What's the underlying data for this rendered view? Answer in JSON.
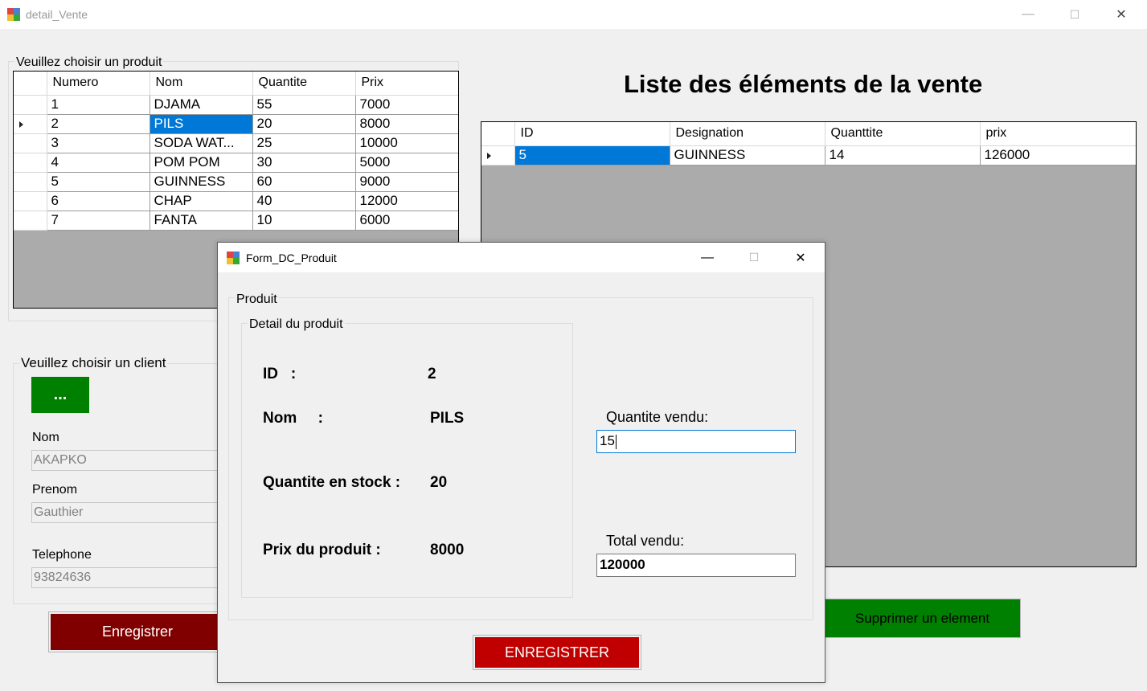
{
  "window": {
    "title": "detail_Vente",
    "minimize": "—",
    "maximize": "☐",
    "close": "✕"
  },
  "products": {
    "legend": "Veuillez choisir un produit",
    "columns": [
      "Numero",
      "Nom",
      "Quantite",
      "Prix"
    ],
    "rows": [
      [
        "1",
        "DJAMA",
        "55",
        "7000"
      ],
      [
        "2",
        "PILS",
        "20",
        "8000"
      ],
      [
        "3",
        "SODA WAT...",
        "25",
        "10000"
      ],
      [
        "4",
        "POM POM",
        "30",
        "5000"
      ],
      [
        "5",
        "GUINNESS",
        "60",
        "9000"
      ],
      [
        "6",
        "CHAP",
        "40",
        "12000"
      ],
      [
        "7",
        "FANTA",
        "10",
        "6000"
      ]
    ]
  },
  "sale": {
    "heading": "Liste des éléments de la vente",
    "columns": [
      "ID",
      "Designation",
      "Quanttite",
      "prix"
    ],
    "rows": [
      [
        "5",
        "GUINNESS",
        "14",
        "126000"
      ]
    ]
  },
  "client": {
    "legend": "Veuillez choisir un client",
    "pick_button": "...",
    "nom_label": "Nom",
    "nom_value": "AKAPKO",
    "prenom_label": "Prenom",
    "prenom_value": "Gauthier",
    "tel_label": "Telephone",
    "tel_value": "93824636"
  },
  "buttons": {
    "save": "Enregistrer",
    "delete": "Supprimer un element"
  },
  "dialog": {
    "title": "Form_DC_Produit",
    "minimize": "—",
    "maximize": "☐",
    "close": "✕",
    "group": "Produit",
    "detail_group": "Detail du produit",
    "id_label": "ID   :",
    "id_value": "2",
    "nom_label": "Nom     :",
    "nom_value": "PILS",
    "stock_label": "Quantite en stock :",
    "stock_value": "20",
    "price_label": "Prix du produit :",
    "price_value": "8000",
    "qty_label": "Quantite vendu:",
    "qty_value": "15",
    "total_label": "Total vendu:",
    "total_value": "120000",
    "save_button": "ENREGISTRER"
  },
  "colors": {
    "selection": "#0078d7",
    "save_dark": "#800000",
    "delete_green": "#008000",
    "dialog_save": "#c00000"
  }
}
